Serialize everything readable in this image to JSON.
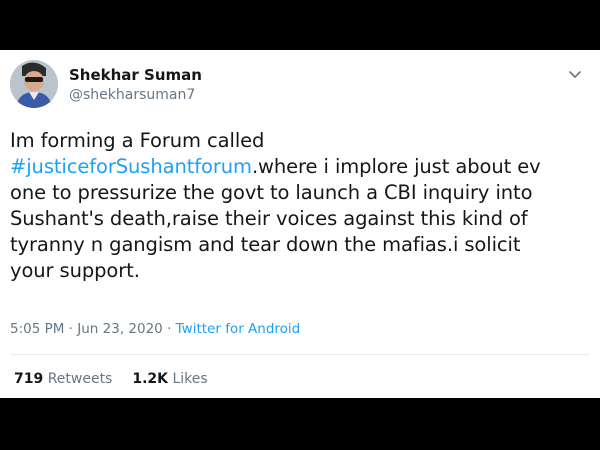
{
  "author": {
    "name": "Shekhar Suman",
    "handle": "@shekharsuman7"
  },
  "icons": {
    "menu": "chevron-down-icon",
    "avatar": "profile-photo"
  },
  "tweet": {
    "line1": "Im forming a Forum called",
    "hashtag": "#justiceforSushantforum",
    "rest": ".where i implore just about ev\none to pressurize the govt to launch a CBI inquiry into\nSushant's death,raise their voices against this kind of\ntyranny n gangism and tear down the mafias.i solicit\nyour support."
  },
  "meta": {
    "timestamp": "5:05 PM · Jun 23, 2020",
    "separator": " · ",
    "source": "Twitter for Android"
  },
  "stats": {
    "retweets_count": "719",
    "retweets_label": "Retweets",
    "likes_count": "1.2K",
    "likes_label": "Likes"
  },
  "colors": {
    "link": "#1da1f2",
    "text": "#14171a",
    "secondary": "#657786"
  }
}
